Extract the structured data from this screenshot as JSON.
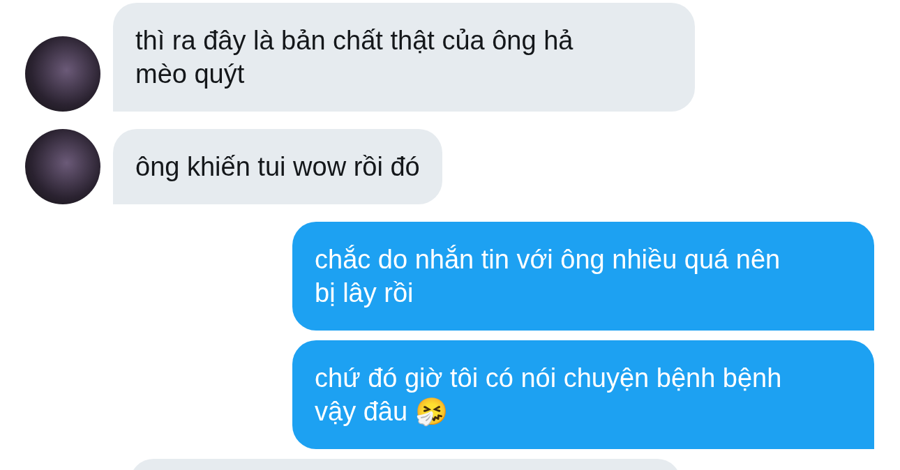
{
  "messages": [
    {
      "kind": "received",
      "avatar": true,
      "text": "thì ra đây là bản chất thật của ông hả\nmèo quýt"
    },
    {
      "kind": "received",
      "avatar": true,
      "text": "ông khiến tui wow rồi đó"
    },
    {
      "kind": "sent",
      "avatar": false,
      "text": "chắc do nhắn tin với ông nhiều quá nên\nbị lây rồi"
    },
    {
      "kind": "sent",
      "avatar": false,
      "text": "chứ đó giờ tôi có nói chuyện bệnh bệnh\nvậy đâu 🤧"
    }
  ]
}
